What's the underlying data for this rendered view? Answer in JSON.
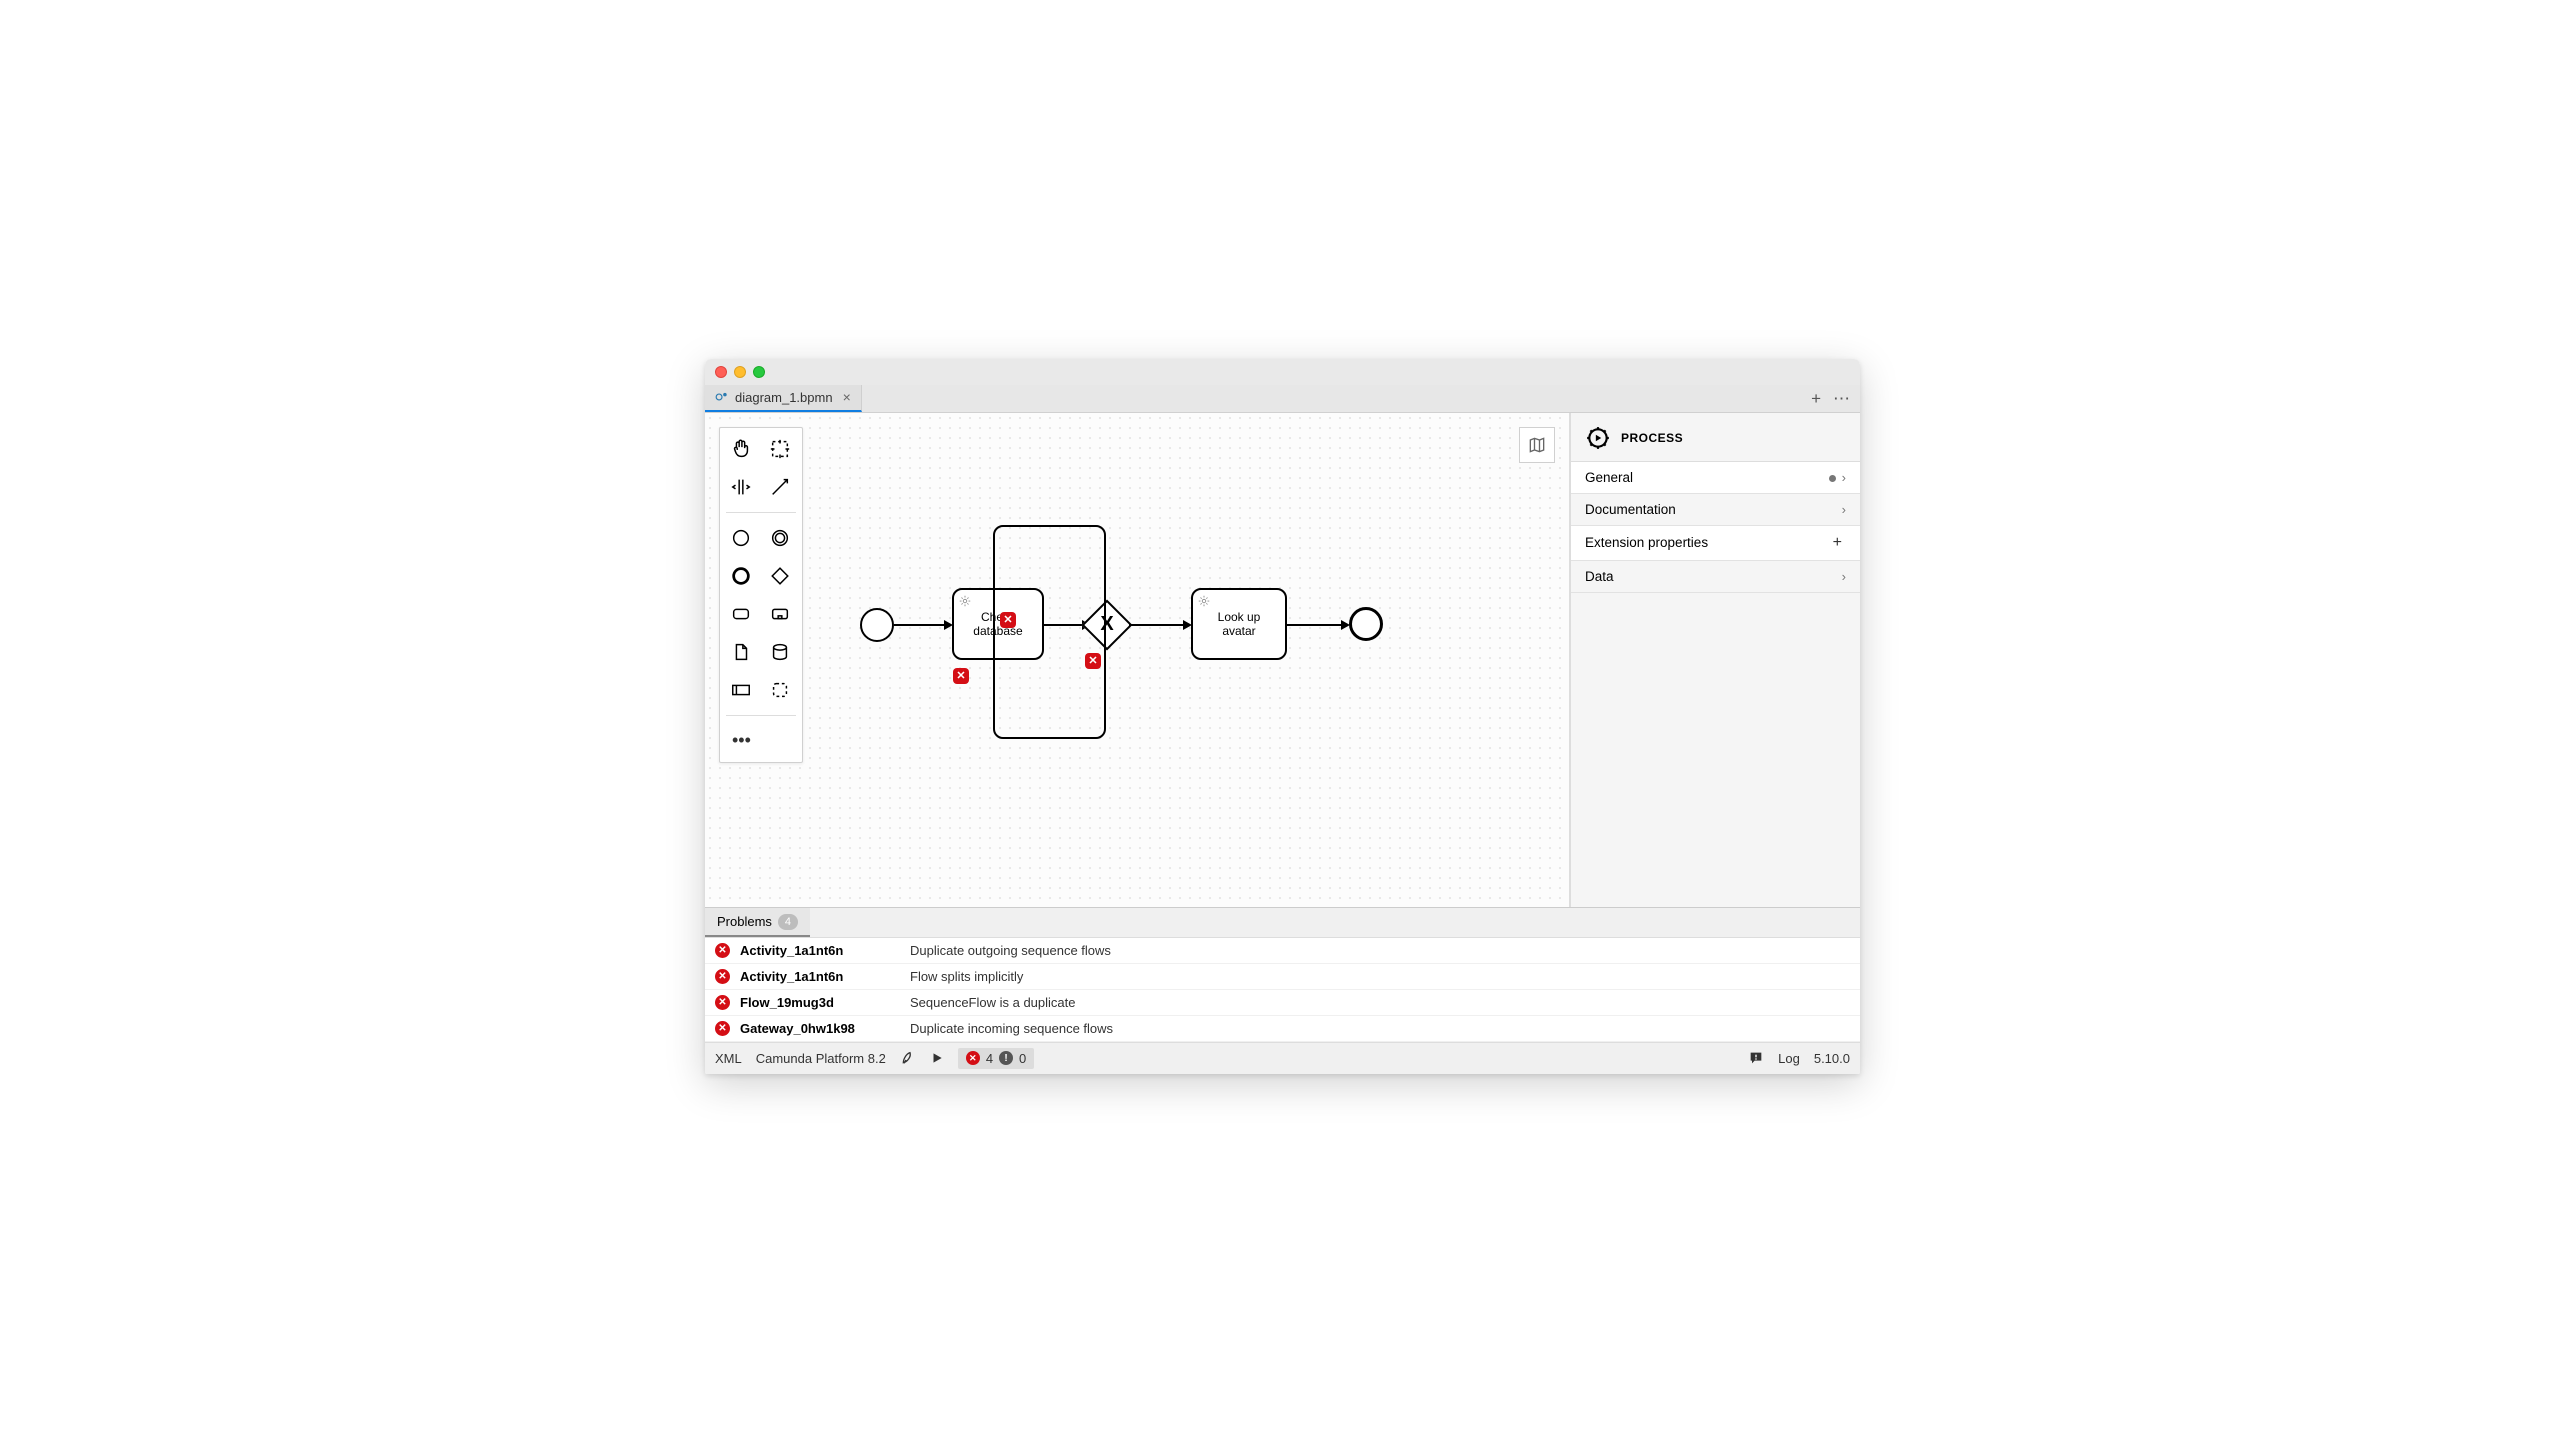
{
  "tab": {
    "filename": "diagram_1.bpmn"
  },
  "palette": {
    "tools": [
      "hand-tool",
      "lasso-tool",
      "space-tool",
      "global-connect-tool",
      "start-event",
      "intermediate-event",
      "end-event",
      "gateway",
      "task",
      "subprocess",
      "data-object",
      "data-store",
      "participant",
      "group"
    ]
  },
  "diagram": {
    "task1_label": "Check database",
    "task2_label": "Look up avatar"
  },
  "properties": {
    "heading": "PROCESS",
    "sections": [
      {
        "label": "General",
        "indicator": "dot",
        "chevron": true
      },
      {
        "label": "Documentation",
        "chevron": true
      },
      {
        "label": "Extension properties",
        "indicator": "plus"
      },
      {
        "label": "Data",
        "chevron": true
      }
    ]
  },
  "problems": {
    "tab_label": "Problems",
    "count": "4",
    "items": [
      {
        "id": "Activity_1a1nt6n",
        "message": "Duplicate outgoing sequence flows"
      },
      {
        "id": "Activity_1a1nt6n",
        "message": "Flow splits implicitly"
      },
      {
        "id": "Flow_19mug3d",
        "message": "SequenceFlow is a duplicate"
      },
      {
        "id": "Gateway_0hw1k98",
        "message": "Duplicate incoming sequence flows"
      }
    ]
  },
  "footer": {
    "xml_toggle": "XML",
    "platform": "Camunda Platform 8.2",
    "error_count": "4",
    "warning_count": "0",
    "log_label": "Log",
    "version": "5.10.0"
  }
}
